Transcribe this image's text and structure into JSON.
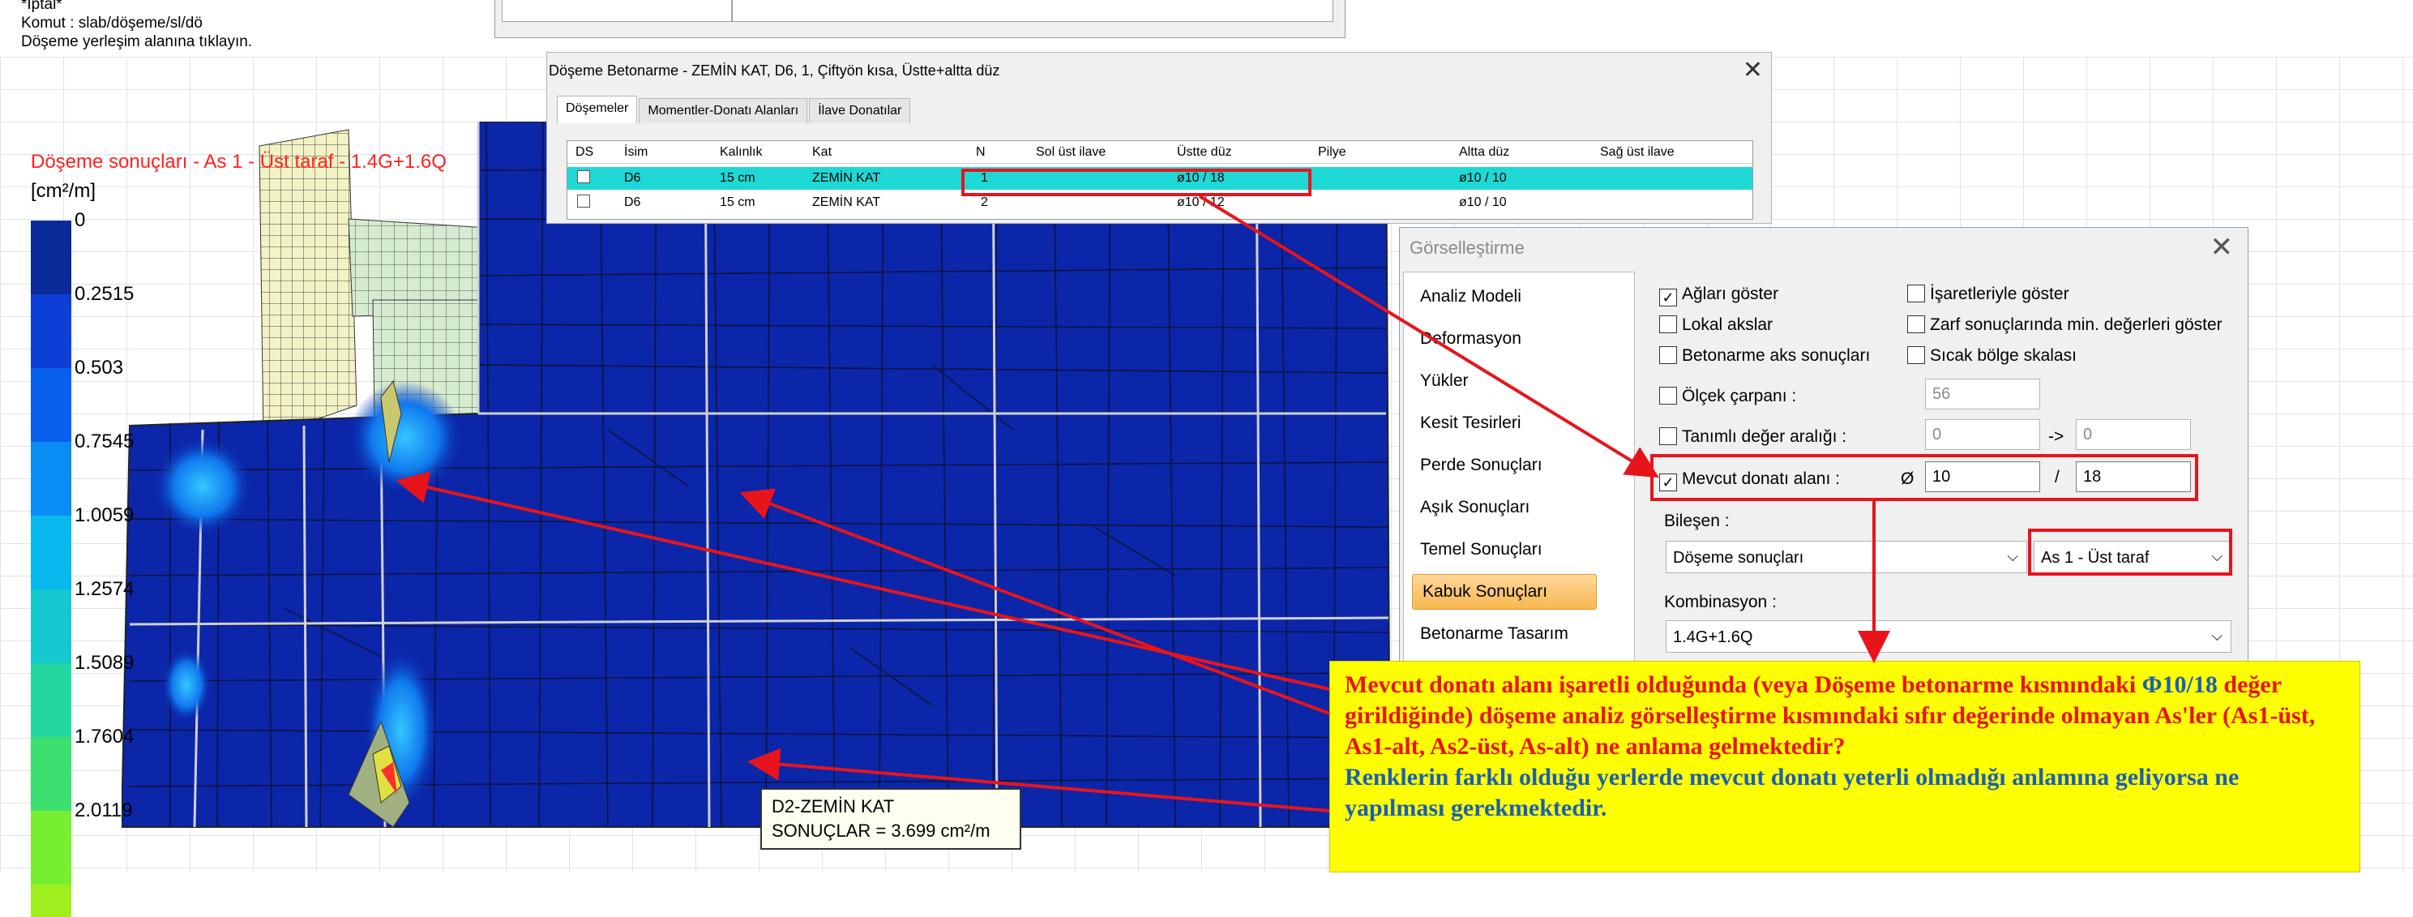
{
  "command_lines": [
    "*İptal*",
    "Komut : slab/döşeme/sl/dö",
    "Döşeme yerleşim alanına tıklayın."
  ],
  "slab_dialog": {
    "title": "Döşeme Betonarme - ZEMİN KAT, D6, 1, Çiftyön kısa, Üstte+altta düz",
    "tabs": [
      "Döşemeler",
      "Momentler-Donatı Alanları",
      "İlave Donatılar"
    ],
    "columns": [
      "DS",
      "İsim",
      "Kalınlık",
      "Kat",
      "N",
      "Sol üst ilave",
      "Üstte düz",
      "Pilye",
      "Altta düz",
      "Sağ üst ilave"
    ],
    "rows": [
      {
        "isim": "D6",
        "kalinlik": "15 cm",
        "kat": "ZEMİN KAT",
        "n": "1",
        "ustte_duz": "ø10 / 18",
        "altta_duz": "ø10 / 10"
      },
      {
        "isim": "D6",
        "kalinlik": "15 cm",
        "kat": "ZEMİN KAT",
        "n": "2",
        "ustte_duz": "ø10 / 12",
        "altta_duz": "ø10 / 10"
      }
    ]
  },
  "legend": {
    "title": "Döşeme sonuçları - As 1 - Üst taraf - 1.4G+1.6Q",
    "unit": "[cm²/m]",
    "values": [
      "0",
      "0.2515",
      "0.503",
      "0.7545",
      "1.0059",
      "1.2574",
      "1.5089",
      "1.7604",
      "2.0119"
    ],
    "colors": [
      "#0a2a9a",
      "#0b3fd6",
      "#0a60ee",
      "#0a8cf5",
      "#0ab8f0",
      "#14c8d0",
      "#22d8a0",
      "#3ce070",
      "#78ee30",
      "#a0f020"
    ]
  },
  "vis_dialog": {
    "title": "Görselleştirme",
    "nav": [
      "Analiz Modeli",
      "Deformasyon",
      "Yükler",
      "Kesit Tesirleri",
      "Perde Sonuçları",
      "Aşık Sonuçları",
      "Temel Sonuçları",
      "Kabuk Sonuçları",
      "Betonarme Tasarım"
    ],
    "active_nav": "Kabuk Sonuçları",
    "checks": {
      "aglari_goster": {
        "label": "Ağları göster",
        "checked": true
      },
      "isaretleriyle": {
        "label": "İşaretleriyle göster",
        "checked": false
      },
      "lokal_akslar": {
        "label": "Lokal akslar",
        "checked": false
      },
      "zarf_min": {
        "label": "Zarf sonuçlarında min. değerleri göster",
        "checked": false
      },
      "betonarme_aks": {
        "label": "Betonarme aks sonuçları",
        "checked": false
      },
      "sicak_bolge": {
        "label": "Sıcak bölge skalası",
        "checked": false
      },
      "olcek": {
        "label": "Ölçek çarpanı :",
        "checked": false
      },
      "tanimli": {
        "label": "Tanımlı değer aralığı :",
        "checked": false
      },
      "mevcut": {
        "label": "Mevcut donatı alanı :",
        "checked": true
      }
    },
    "olcek_value": "56",
    "range_from": "0",
    "range_arrow": "->",
    "range_to": "0",
    "phi_symbol": "Ø",
    "phi_value": "10",
    "slash": "/",
    "spacing_value": "18",
    "bilesen_label": "Bileşen :",
    "bilesen_value": "Döşeme sonuçları",
    "bilesen_sub": "As 1 - Üst taraf",
    "kombinasyon_label": "Kombinasyon :",
    "kombinasyon_value": "1.4G+1.6Q"
  },
  "tooltip": {
    "line1": "D2-ZEMİN KAT",
    "line2": "SONUÇLAR = 3.699 cm²/m"
  },
  "note": {
    "red_text": "Mevcut donatı alanı işaretli olduğunda (veya Döşeme betonarme kısmındaki ",
    "blue_phi": "Φ10/18",
    "red_text2": " değer girildiğinde) döşeme analiz görselleştirme kısmındaki  sıfır değerinde olmayan As'ler (As1-üst, As1-alt, As2-üst, As-alt) ne anlama gelmektedir?",
    "blue_text": "Renklerin farklı olduğu yerlerde mevcut donatı yeterli olmadığı anlamına geliyorsa ne yapılması gerekmektedir."
  }
}
